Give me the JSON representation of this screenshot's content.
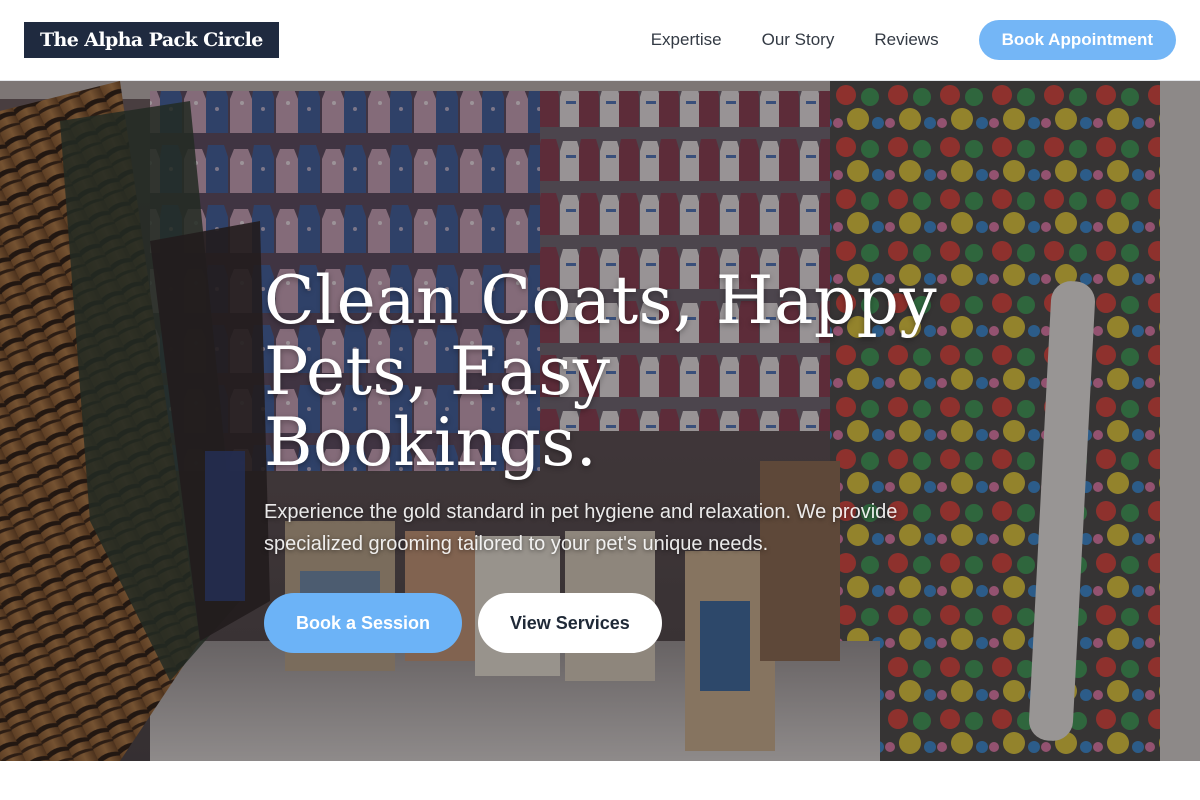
{
  "brand": {
    "name": "The Alpha Pack Circle"
  },
  "nav": {
    "items": [
      {
        "label": "Expertise"
      },
      {
        "label": "Our Story"
      },
      {
        "label": "Reviews"
      }
    ],
    "cta_label": "Book Appointment"
  },
  "hero": {
    "title_line1": "Clean Coats, Happy",
    "title_line2": "Pets, Easy Bookings.",
    "subtitle": "Experience the gold standard in pet hygiene and relaxation. We provide specialized grooming tailored to your pet's unique needs.",
    "primary_cta": "Book a Session",
    "secondary_cta": "View Services",
    "background_image": "pet-store-interior"
  },
  "colors": {
    "brand_dark": "#1f2a3f",
    "accent_blue": "#74b6f6",
    "white": "#ffffff"
  }
}
